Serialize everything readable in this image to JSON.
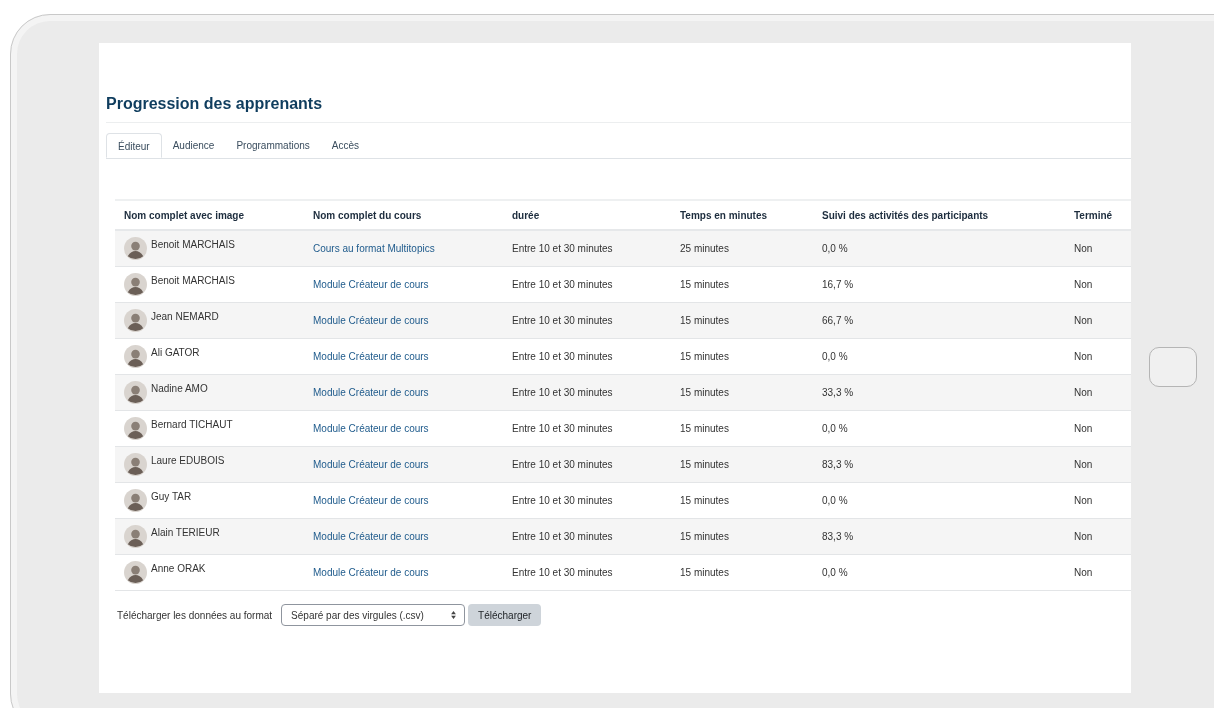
{
  "page": {
    "title": "Progression des apprenants"
  },
  "tabs": [
    {
      "label": "Éditeur",
      "selected": true
    },
    {
      "label": "Audience",
      "selected": false
    },
    {
      "label": "Programmations",
      "selected": false
    },
    {
      "label": "Accès",
      "selected": false
    }
  ],
  "table": {
    "columns": [
      "Nom complet avec image",
      "Nom complet du cours",
      "durée",
      "Temps en minutes",
      "Suivi des activités des participants",
      "Terminé"
    ],
    "rows": [
      {
        "name": "Benoit MARCHAIS",
        "course": "Cours au format Multitopics",
        "duration": "Entre 10 et 30 minutes",
        "time": "25 minutes",
        "progress": "0,0 %",
        "completed": "Non"
      },
      {
        "name": "Benoit MARCHAIS",
        "course": "Module Créateur de cours",
        "duration": "Entre 10 et 30 minutes",
        "time": "15 minutes",
        "progress": "16,7 %",
        "completed": "Non"
      },
      {
        "name": "Jean NEMARD",
        "course": "Module Créateur de cours",
        "duration": "Entre 10 et 30 minutes",
        "time": "15 minutes",
        "progress": "66,7 %",
        "completed": "Non"
      },
      {
        "name": "Ali GATOR",
        "course": "Module Créateur de cours",
        "duration": "Entre 10 et 30 minutes",
        "time": "15 minutes",
        "progress": "0,0 %",
        "completed": "Non"
      },
      {
        "name": "Nadine AMO",
        "course": "Module Créateur de cours",
        "duration": "Entre 10 et 30 minutes",
        "time": "15 minutes",
        "progress": "33,3 %",
        "completed": "Non"
      },
      {
        "name": "Bernard TICHAUT",
        "course": "Module Créateur de cours",
        "duration": "Entre 10 et 30 minutes",
        "time": "15 minutes",
        "progress": "0,0 %",
        "completed": "Non"
      },
      {
        "name": "Laure EDUBOIS",
        "course": "Module Créateur de cours",
        "duration": "Entre 10 et 30 minutes",
        "time": "15 minutes",
        "progress": "83,3 %",
        "completed": "Non"
      },
      {
        "name": "Guy TAR",
        "course": "Module Créateur de cours",
        "duration": "Entre 10 et 30 minutes",
        "time": "15 minutes",
        "progress": "0,0 %",
        "completed": "Non"
      },
      {
        "name": "Alain TERIEUR",
        "course": "Module Créateur de cours",
        "duration": "Entre 10 et 30 minutes",
        "time": "15 minutes",
        "progress": "83,3 %",
        "completed": "Non"
      },
      {
        "name": "Anne ORAK",
        "course": "Module Créateur de cours",
        "duration": "Entre 10 et 30 minutes",
        "time": "15 minutes",
        "progress": "0,0 %",
        "completed": "Non"
      }
    ]
  },
  "download": {
    "label": "Télécharger les données au format",
    "format": "Séparé par des virgules (.csv)",
    "button": "Télécharger"
  }
}
